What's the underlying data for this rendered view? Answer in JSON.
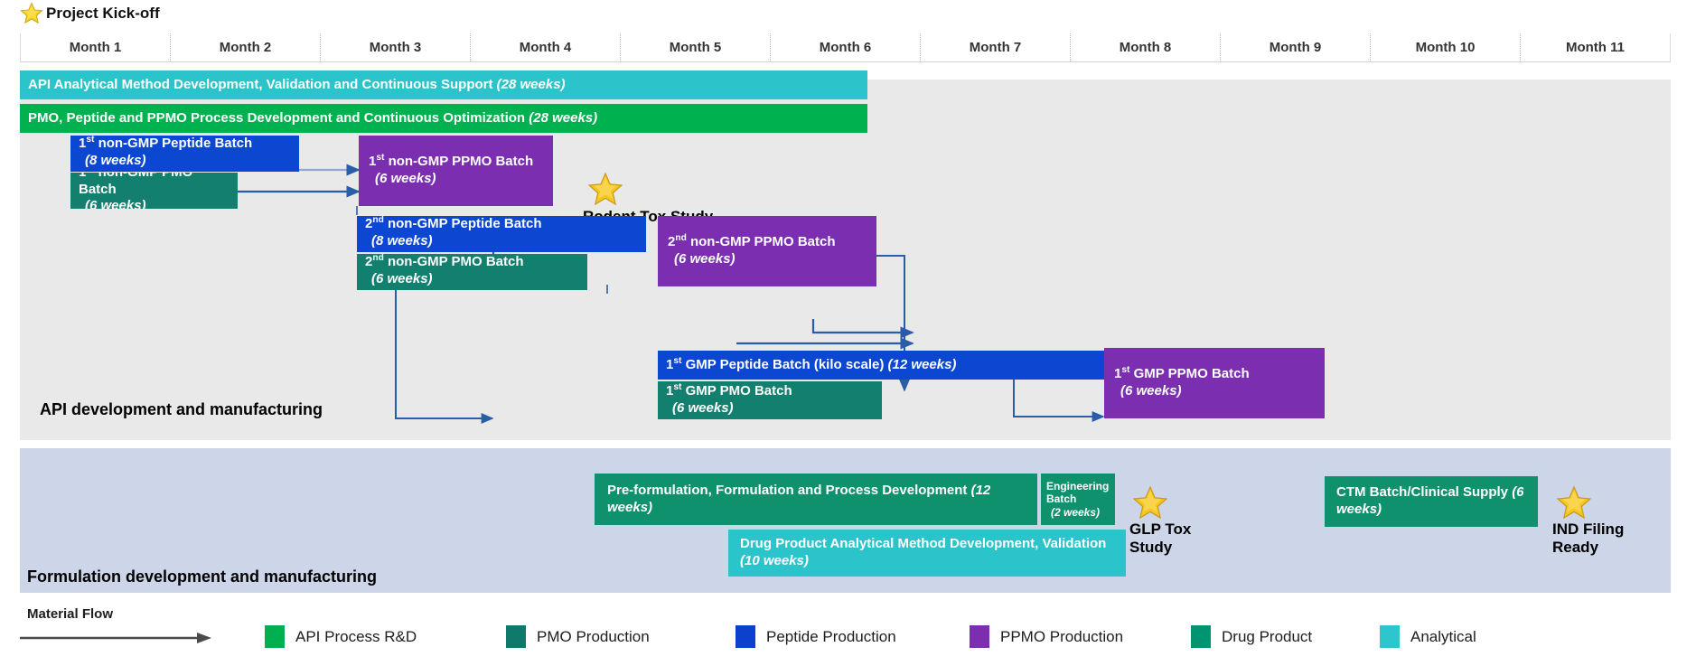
{
  "milestones": {
    "kickoff": "Project Kick-off",
    "rodent_tox": "Rodent Tox Study",
    "glp_tox": "GLP Tox\nStudy",
    "glp_tox_line1": "GLP Tox",
    "glp_tox_line2": "Study",
    "ind_line1": "IND Filing",
    "ind_line2": "Ready"
  },
  "timeline": {
    "months": [
      "Month 1",
      "Month 2",
      "Month 3",
      "Month 4",
      "Month 5",
      "Month 6",
      "Month 7",
      "Month 8",
      "Month 9",
      "Month 10",
      "Month 11"
    ]
  },
  "swimlanes": {
    "api": "API development and manufacturing",
    "formulation": "Formulation development and manufacturing"
  },
  "tasks": {
    "api_analytical": {
      "title": "API Analytical Method Development, Validation and Continuous Support",
      "duration": "(28 weeks)"
    },
    "pmo_process": {
      "title": "PMO, Peptide and PPMO Process Development and Continuous Optimization",
      "duration": "(28 weeks)"
    },
    "peptide1": {
      "ord": "1",
      "sup": "st",
      "title": " non-GMP Peptide Batch",
      "duration": "(8 weeks)"
    },
    "pmo1": {
      "ord": "1",
      "sup": "st",
      "title": " non-GMP PMO Batch",
      "duration": "(6 weeks)"
    },
    "ppmo1": {
      "ord": "1",
      "sup": "st",
      "title": " non-GMP PPMO Batch",
      "duration": "(6 weeks)"
    },
    "peptide2": {
      "ord": "2",
      "sup": "nd",
      "title": " non-GMP Peptide Batch",
      "duration": "(8 weeks)"
    },
    "pmo2": {
      "ord": "2",
      "sup": "nd",
      "title": " non-GMP PMO  Batch",
      "duration": "(6 weeks)"
    },
    "ppmo2": {
      "ord": "2",
      "sup": "nd",
      "title": " non-GMP PPMO Batch",
      "duration": "(6 weeks)"
    },
    "gmp_peptide1": {
      "ord": "1",
      "sup": "st",
      "title": " GMP Peptide Batch (kilo scale) ",
      "duration": "(12 weeks)"
    },
    "gmp_pmo1": {
      "ord": "1",
      "sup": "st",
      "title": " GMP PMO Batch",
      "duration": "(6 weeks)"
    },
    "gmp_ppmo1": {
      "ord": "1",
      "sup": "st",
      "title": " GMP PPMO Batch",
      "duration": "(6 weeks)"
    },
    "preformulation": {
      "title": "Pre-formulation, Formulation and Process Development ",
      "duration": "(12 weeks)"
    },
    "engineering_batch": {
      "title": "Engineering Batch",
      "duration": "(2 weeks)"
    },
    "dp_analytical": {
      "title": "Drug Product Analytical Method Development, Validation ",
      "duration": "(10 weeks)"
    },
    "ctm_batch": {
      "title": "CTM Batch/Clinical Supply ",
      "duration": "(6 weeks)"
    }
  },
  "legend": {
    "material_flow": "Material Flow",
    "items": [
      {
        "label": "API Process R&D",
        "color": "#00b050"
      },
      {
        "label": "PMO Production",
        "color": "#0f7a6c"
      },
      {
        "label": "Peptide Production",
        "color": "#0b41cd"
      },
      {
        "label": "PPMO Production",
        "color": "#7b2fb0"
      },
      {
        "label": "Drug Product",
        "color": "#009470"
      },
      {
        "label": "Analytical",
        "color": "#2ec6cd"
      }
    ]
  },
  "colors": {
    "analytical": "#2bc4cb",
    "api_process": "#00b24f",
    "peptide": "#0b47d0",
    "pmo": "#13806f",
    "ppmo": "#7b2fb0",
    "drug_product": "#10916e",
    "api_lane_bg": "#e9e9e9",
    "form_lane_bg": "#ccd6e8",
    "arrow": "#2b5ca8",
    "star": "#f2c12e"
  }
}
